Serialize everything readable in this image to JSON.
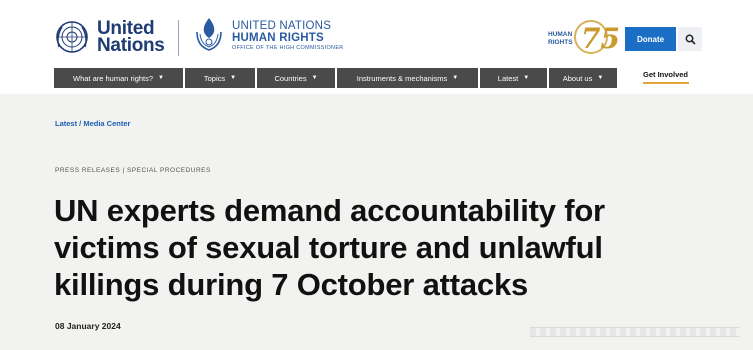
{
  "header": {
    "un_logo": {
      "line1": "United",
      "line2": "Nations",
      "icon": "un-emblem-icon"
    },
    "ohchr_logo": {
      "line1": "UNITED NATIONS",
      "line2": "HUMAN RIGHTS",
      "line3": "OFFICE OF THE HIGH COMMISSIONER",
      "icon": "ohchr-flame-icon"
    },
    "hr75": {
      "line1": "HUMAN",
      "line2": "RIGHTS",
      "number": "75"
    },
    "donate_label": "Donate",
    "search_icon": "search-icon"
  },
  "nav": {
    "items": [
      {
        "label": "What are human rights?"
      },
      {
        "label": "Topics"
      },
      {
        "label": "Countries"
      },
      {
        "label": "Instruments & mechanisms"
      },
      {
        "label": "Latest"
      },
      {
        "label": "About us"
      }
    ],
    "get_involved": "Get Involved"
  },
  "article": {
    "breadcrumb": "Latest / Media Center",
    "kicker": "PRESS RELEASES  |  SPECIAL PROCEDURES",
    "headline_lines": [
      "UN experts demand accountability for",
      "victims of sexual torture and unlawful",
      "killings during 7 October attacks"
    ],
    "date": "08 January 2024"
  },
  "colors": {
    "un_blue": "#1f3c73",
    "ohchr_blue": "#2a5aa0",
    "donate_blue": "#1a6ec6",
    "nav_bg": "#4a4a4a",
    "accent_gold": "#e6a23c",
    "content_bg": "#f2f2f0"
  }
}
